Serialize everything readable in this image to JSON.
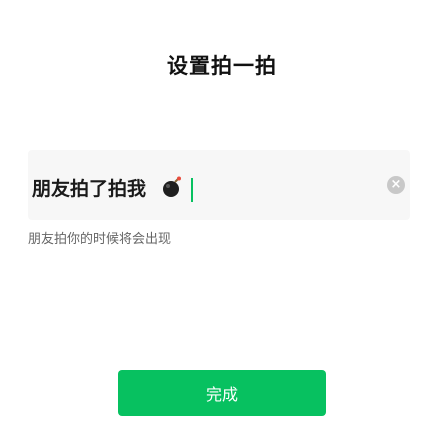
{
  "page": {
    "title": "设置拍一拍"
  },
  "input": {
    "value": "朋友拍了拍我",
    "emoji_icon": "bomb-icon",
    "clear_icon": "clear-circle-icon"
  },
  "hint": {
    "text": "朋友拍你的时候将会出现"
  },
  "actions": {
    "done_label": "完成"
  },
  "colors": {
    "accent": "#07c160",
    "background": "#ffffff",
    "input_background": "#f7f7f7",
    "hint_text": "#666666"
  }
}
